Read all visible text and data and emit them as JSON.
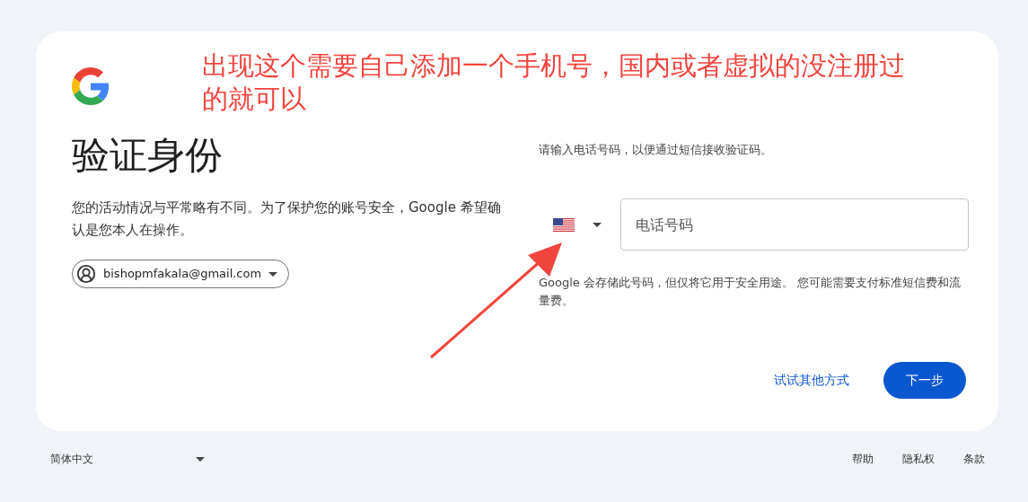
{
  "annotation": {
    "text": "出现这个需要自己添加一个手机号，国内或者虚拟的没注册过的就可以"
  },
  "title": "验证身份",
  "description": "您的活动情况与平常略有不同。为了保护您的账号安全，Google 希望确认是您本人在操作。",
  "account": {
    "email": "bishopmfakala@gmail.com"
  },
  "phone": {
    "prompt": "请输入电话号码，以便通过短信接收验证码。",
    "placeholder": "电话号码",
    "note": "Google 会存储此号码，但仅将它用于安全用途。 您可能需要支付标准短信费和流量费。"
  },
  "actions": {
    "other": "试试其他方式",
    "next": "下一步"
  },
  "footer": {
    "language": "简体中文",
    "links": [
      "帮助",
      "隐私权",
      "条款"
    ]
  }
}
